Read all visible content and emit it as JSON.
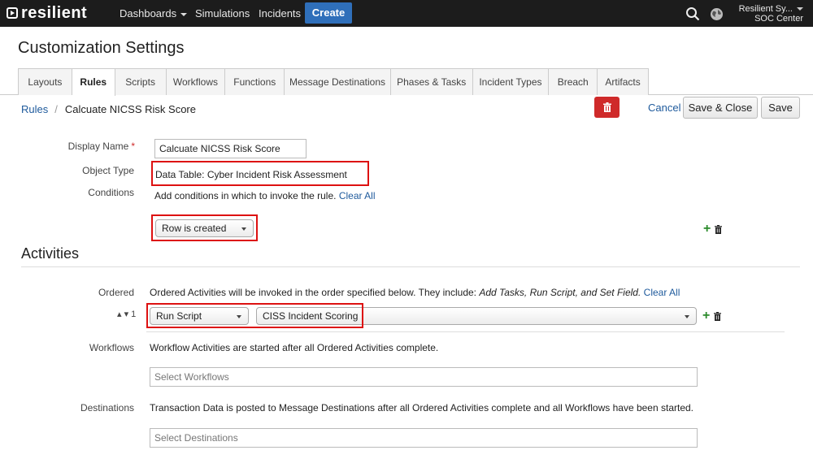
{
  "topbar": {
    "brand": "resilient",
    "nav": [
      "Dashboards",
      "Simulations",
      "Incidents"
    ],
    "create_label": "Create",
    "user_name": "Resilient Sy...",
    "org_name": "SOC Center"
  },
  "page": {
    "title": "Customization Settings",
    "tabs": [
      "Layouts",
      "Rules",
      "Scripts",
      "Workflows",
      "Functions",
      "Message Destinations",
      "Phases & Tasks",
      "Incident Types",
      "Breach",
      "Artifacts"
    ],
    "active_tab": "Rules"
  },
  "breadcrumb": {
    "parent": "Rules",
    "separator": "/",
    "current": "Calcuate NICSS Risk Score"
  },
  "actions": {
    "cancel": "Cancel",
    "save_close": "Save & Close",
    "save": "Save"
  },
  "form": {
    "display_name_label": "Display Name",
    "required_mark": "*",
    "display_name_value": "Calcuate NICSS Risk Score",
    "object_type_label": "Object Type",
    "object_type_value": "Data Table: Cyber Incident Risk Assessment",
    "conditions_label": "Conditions",
    "conditions_text": "Add conditions in which to invoke the rule.",
    "conditions_clear": "Clear All",
    "condition_select": "Row is created"
  },
  "activities": {
    "title": "Activities",
    "ordered_label": "Ordered",
    "ordered_text": "Ordered Activities will be invoked in the order specified below. They include: ",
    "ordered_italic": "Add Tasks, Run Script, and Set Field.",
    "ordered_clear": "Clear All",
    "order_number": "1",
    "action_select": "Run Script",
    "script_select": "CISS Incident Scoring",
    "workflows_label": "Workflows",
    "workflows_text": "Workflow Activities are started after all Ordered Activities complete.",
    "workflows_placeholder": "Select Workflows",
    "destinations_label": "Destinations",
    "destinations_text": "Transaction Data is posted to Message Destinations after all Ordered Activities complete and all Workflows have been started.",
    "destinations_placeholder": "Select Destinations"
  },
  "colors": {
    "topbar": "#1c1c1c",
    "create": "#2f6fba",
    "link": "#1e5a9c",
    "danger": "#cf2a2a",
    "highlight": "#dd1111",
    "add": "#2a8a2a"
  },
  "icons": [
    "logo-mark-icon",
    "search-icon",
    "globe-icon",
    "trash-icon",
    "plus-icon",
    "chevron-down-icon",
    "sort-arrows-icon"
  ]
}
